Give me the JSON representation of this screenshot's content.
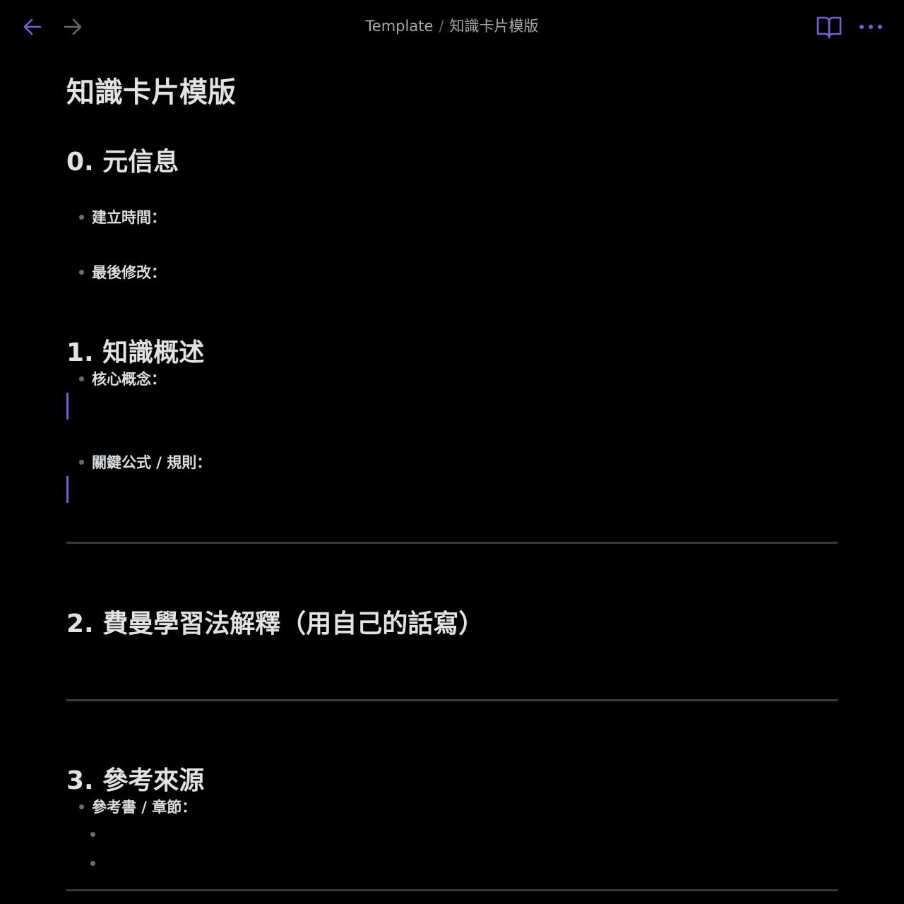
{
  "topbar": {
    "breadcrumb_folder": "Template",
    "breadcrumb_separator": "/",
    "breadcrumb_file": "知識卡片模版",
    "icons": {
      "back": "arrow-left-icon",
      "forward": "arrow-right-icon",
      "reading": "book-open-icon",
      "more": "more-horizontal-icon"
    },
    "accent_color": "#7b5fd0"
  },
  "note": {
    "title": "知識卡片模版",
    "sections": [
      {
        "heading": "0. 元信息",
        "items": [
          "建立時間：",
          "最後修改："
        ]
      },
      {
        "heading": "1. 知識概述",
        "items": [
          "核心概念：",
          "關鍵公式 / 規則："
        ]
      },
      {
        "heading": "2. 費曼學習法解釋（用自己的話寫）",
        "items": []
      },
      {
        "heading": "3. 參考來源",
        "items": [
          "參考書 / 章節："
        ]
      }
    ]
  }
}
